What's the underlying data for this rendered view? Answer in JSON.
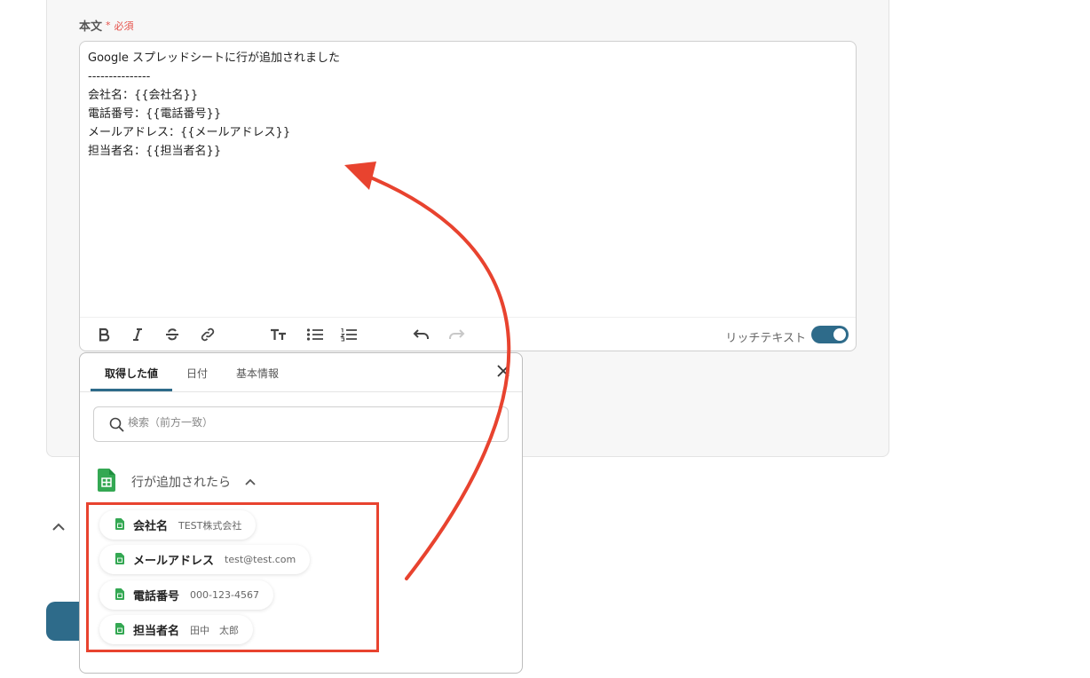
{
  "form": {
    "field_label": "本文",
    "required_mark": "*",
    "required_text": "必須"
  },
  "editor": {
    "lines": [
      "Google スプレッドシートに行が追加されました",
      "---------------",
      "会社名：{{会社名}}",
      "電話番号：{{電話番号}}",
      "メールアドレス：{{メールアドレス}}",
      "担当者名：{{担当者名}}"
    ],
    "rich_text_label": "リッチテキスト",
    "rich_text_enabled": true,
    "toolbar_icons": [
      "bold-icon",
      "italic-icon",
      "strikethrough-icon",
      "link-icon",
      "text-size-icon",
      "bullet-list-icon",
      "numbered-list-icon",
      "undo-icon",
      "redo-icon"
    ]
  },
  "popup": {
    "tabs": [
      {
        "label": "取得した値",
        "active": true
      },
      {
        "label": "日付",
        "active": false
      },
      {
        "label": "基本情報",
        "active": false
      }
    ],
    "search_placeholder": "検索（前方一致）",
    "section_title": "行が追加されたら",
    "items": [
      {
        "key": "会社名",
        "value": "TEST株式会社"
      },
      {
        "key": "メールアドレス",
        "value": "test@test.com"
      },
      {
        "key": "電話番号",
        "value": "000-123-4567"
      },
      {
        "key": "担当者名",
        "value": "田中　太郎"
      }
    ]
  },
  "colors": {
    "accent": "#2e6b8a",
    "annotation": "#e8432f",
    "required": "#e5514a",
    "sheets_green": "#34a853"
  }
}
